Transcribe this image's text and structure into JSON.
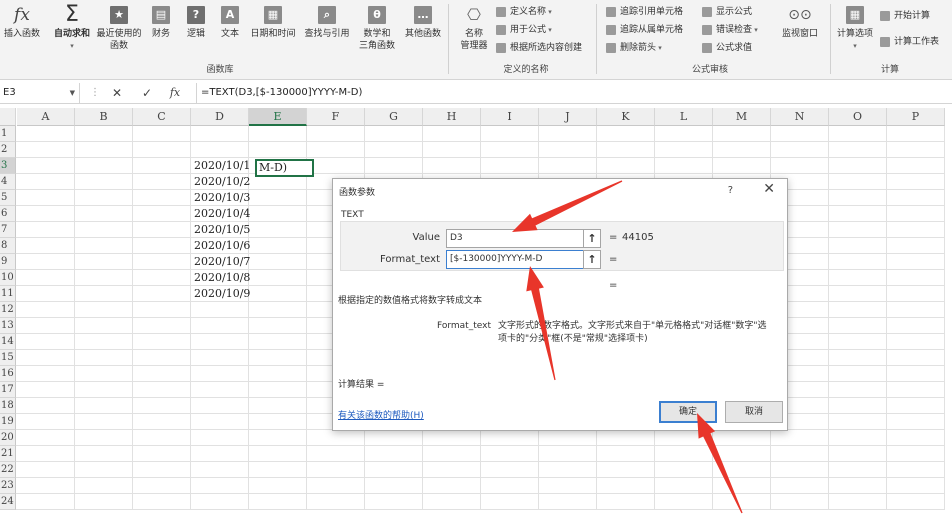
{
  "ribbon": {
    "buttons": [
      {
        "label": "插入函数",
        "icon": "fx-icon"
      },
      {
        "label": "自动求和",
        "icon": "sigma-icon"
      },
      {
        "label": "最近使用的",
        "label2": "函数",
        "icon": "star-icon"
      },
      {
        "label": "财务",
        "icon": "finance-icon"
      },
      {
        "label": "逻辑",
        "icon": "logic-icon"
      },
      {
        "label": "文本",
        "icon": "text-icon"
      },
      {
        "label": "日期和时间",
        "icon": "date-time-icon"
      },
      {
        "label": "查找与引用",
        "icon": "lookup-icon"
      },
      {
        "label": "数学和",
        "label2": "三角函数",
        "icon": "math-icon"
      },
      {
        "label": "其他函数",
        "icon": "more-functions-icon"
      }
    ],
    "groups": {
      "library": "函数库",
      "names": "定义的名称",
      "audit": "公式审核",
      "calc": "计算"
    },
    "names": {
      "manager": "名称",
      "manager2": "管理器",
      "define": "定义名称",
      "use_in_formula": "用于公式",
      "create_from_selection": "根据所选内容创建"
    },
    "audit": {
      "trace_precedents": "追踪引用单元格",
      "trace_dependents": "追踪从属单元格",
      "remove_arrows": "删除箭头",
      "show_formulas": "显示公式",
      "error_check": "错误检查",
      "evaluate": "公式求值",
      "watch": "监视窗口"
    },
    "calc": {
      "options": "计算选项",
      "calc_now": "开始计算",
      "calc_sheet": "计算工作表"
    }
  },
  "formula_bar": {
    "name_box": "E3",
    "cancel": "✕",
    "enter": "✓",
    "fx": "fx",
    "formula": "=TEXT(D3,[$-130000]YYYY-M-D)"
  },
  "grid": {
    "columns": [
      "A",
      "B",
      "C",
      "D",
      "E",
      "F",
      "G",
      "H",
      "I",
      "J",
      "K",
      "L",
      "M",
      "N",
      "O",
      "P"
    ],
    "rows": [
      "1",
      "2",
      "3",
      "4",
      "5",
      "6",
      "7",
      "8",
      "9",
      "10",
      "11",
      "12",
      "13",
      "14",
      "15",
      "16",
      "17",
      "18",
      "19",
      "20",
      "21",
      "22",
      "23",
      "24"
    ],
    "d_values": [
      "2020/10/1",
      "2020/10/2",
      "2020/10/3",
      "2020/10/4",
      "2020/10/5",
      "2020/10/6",
      "2020/10/7",
      "2020/10/8",
      "2020/10/9"
    ],
    "active_cell_text": "M-D)"
  },
  "dialog": {
    "title": "函数参数",
    "help": "?",
    "close": "✕",
    "function_name": "TEXT",
    "args": [
      {
        "label": "Value",
        "value": "D3",
        "result": "44105"
      },
      {
        "label": "Format_text",
        "value": "[$-130000]YYYY-M-D",
        "result": ""
      }
    ],
    "equals": "=",
    "description": "根据指定的数值格式将数字转成文本",
    "arg_desc_label": "Format_text",
    "arg_desc_line1": "文字形式的数字格式。文字形式来自于\"单元格格式\"对话框\"数字\"选",
    "arg_desc_line2": "项卡的\"分类\"框(不是\"常规\"选择项卡)",
    "result_label": "计算结果 =",
    "help_link": "有关该函数的帮助(H)",
    "ok": "确定",
    "cancel": "取消"
  },
  "colors": {
    "accent_green": "#217346",
    "annotation_red": "#e8352a",
    "link_blue": "#1f5bbf"
  }
}
